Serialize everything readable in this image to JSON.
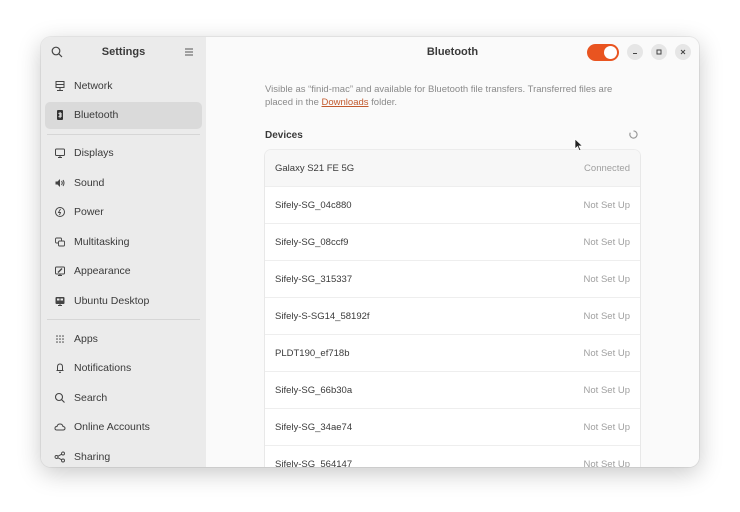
{
  "sidebar": {
    "title": "Settings",
    "search_icon": "search-icon",
    "menu_icon": "hamburger-menu-icon",
    "groups": [
      [
        {
          "label": "Network",
          "icon": "network-icon"
        },
        {
          "label": "Bluetooth",
          "icon": "bluetooth-icon",
          "active": true
        }
      ],
      [
        {
          "label": "Displays",
          "icon": "display-icon"
        },
        {
          "label": "Sound",
          "icon": "speaker-icon"
        },
        {
          "label": "Power",
          "icon": "power-icon"
        },
        {
          "label": "Multitasking",
          "icon": "multitasking-icon"
        },
        {
          "label": "Appearance",
          "icon": "appearance-icon"
        },
        {
          "label": "Ubuntu Desktop",
          "icon": "ubuntu-desktop-icon"
        }
      ],
      [
        {
          "label": "Apps",
          "icon": "apps-grid-icon"
        },
        {
          "label": "Notifications",
          "icon": "bell-icon"
        },
        {
          "label": "Search",
          "icon": "search-icon"
        },
        {
          "label": "Online Accounts",
          "icon": "cloud-icon"
        },
        {
          "label": "Sharing",
          "icon": "share-icon"
        }
      ]
    ]
  },
  "header": {
    "title": "Bluetooth",
    "bluetooth_enabled": true,
    "accent_color": "#e95420",
    "window_controls": [
      "minimize",
      "maximize",
      "close"
    ]
  },
  "main": {
    "description_before": "Visible as “finid-mac” and available for Bluetooth file transfers. Transferred files are placed in the ",
    "description_link": "Downloads",
    "description_after": " folder.",
    "devices_title": "Devices",
    "devices": [
      {
        "name": "Galaxy S21 FE 5G",
        "status": "Connected"
      },
      {
        "name": "Sifely-SG_04c880",
        "status": "Not Set Up"
      },
      {
        "name": "Sifely-SG_08ccf9",
        "status": "Not Set Up"
      },
      {
        "name": "Sifely-SG_315337",
        "status": "Not Set Up"
      },
      {
        "name": "Sifely-S-SG14_58192f",
        "status": "Not Set Up"
      },
      {
        "name": "PLDT190_ef718b",
        "status": "Not Set Up"
      },
      {
        "name": "Sifely-SG_66b30a",
        "status": "Not Set Up"
      },
      {
        "name": "Sifely-SG_34ae74",
        "status": "Not Set Up"
      },
      {
        "name": "Sifely-SG_564147",
        "status": "Not Set Up"
      }
    ]
  }
}
